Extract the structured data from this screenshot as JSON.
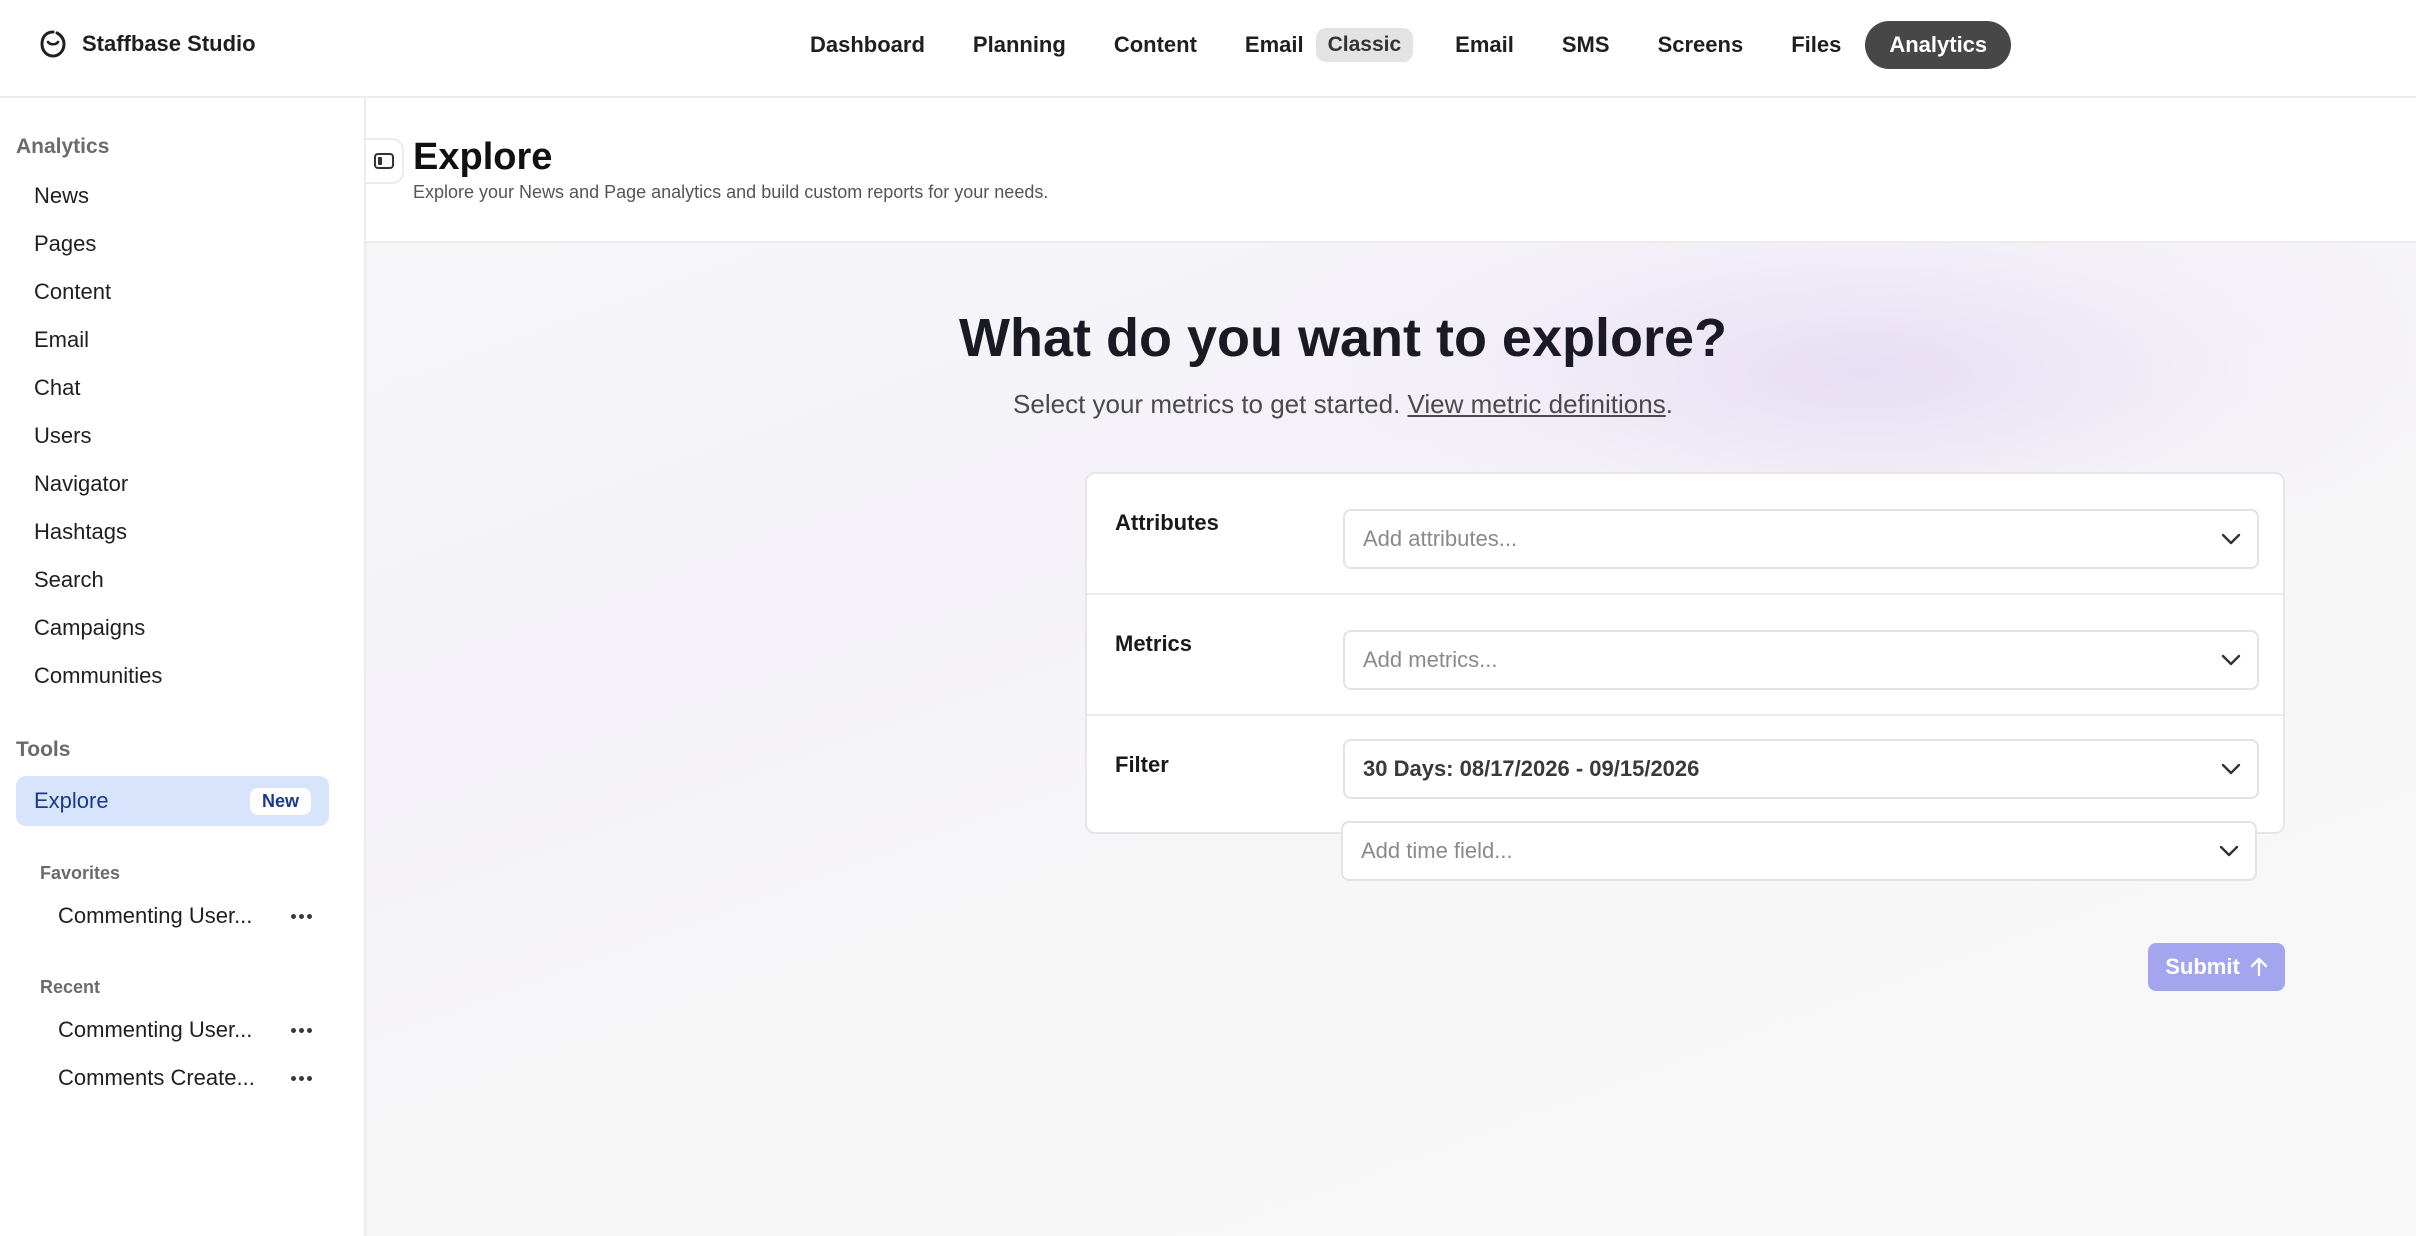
{
  "brand": {
    "name": "Staffbase Studio",
    "logo_icon": "staffbase-logo-icon"
  },
  "nav": {
    "items": [
      {
        "label": "Dashboard"
      },
      {
        "label": "Planning"
      },
      {
        "label": "Content"
      },
      {
        "label": "Email",
        "badge": "Classic"
      },
      {
        "label": "Email"
      },
      {
        "label": "SMS"
      },
      {
        "label": "Screens"
      },
      {
        "label": "Files"
      },
      {
        "label": "Analytics",
        "active": true
      }
    ]
  },
  "sidebar": {
    "analytics_heading": "Analytics",
    "analytics_items": [
      {
        "label": "News"
      },
      {
        "label": "Pages"
      },
      {
        "label": "Content"
      },
      {
        "label": "Email"
      },
      {
        "label": "Chat"
      },
      {
        "label": "Users"
      },
      {
        "label": "Navigator"
      },
      {
        "label": "Hashtags"
      },
      {
        "label": "Search"
      },
      {
        "label": "Campaigns"
      },
      {
        "label": "Communities"
      }
    ],
    "tools_heading": "Tools",
    "explore": {
      "label": "Explore",
      "badge": "New"
    },
    "favorites_heading": "Favorites",
    "favorites": [
      {
        "label": "Commenting User..."
      }
    ],
    "recent_heading": "Recent",
    "recent": [
      {
        "label": "Commenting User..."
      },
      {
        "label": "Comments Create..."
      }
    ]
  },
  "header": {
    "title": "Explore",
    "subtitle": "Explore your News and Page analytics and build custom reports for your needs."
  },
  "hero": {
    "title": "What do you want to explore?",
    "subtitle_prefix": "Select your metrics to get started. ",
    "link": "View metric definitions",
    "subtitle_suffix": "."
  },
  "form": {
    "attributes_label": "Attributes",
    "attributes_placeholder": "Add attributes...",
    "metrics_label": "Metrics",
    "metrics_placeholder": "Add metrics...",
    "filter_label": "Filter",
    "filter_value": "30 Days: 08/17/2026 - 09/15/2026",
    "time_field_placeholder": "Add time field...",
    "submit_label": "Submit"
  },
  "colors": {
    "active_nav": "#474747",
    "explore_highlight": "#d7e4fb",
    "submit_button": "#a3a5ef"
  }
}
